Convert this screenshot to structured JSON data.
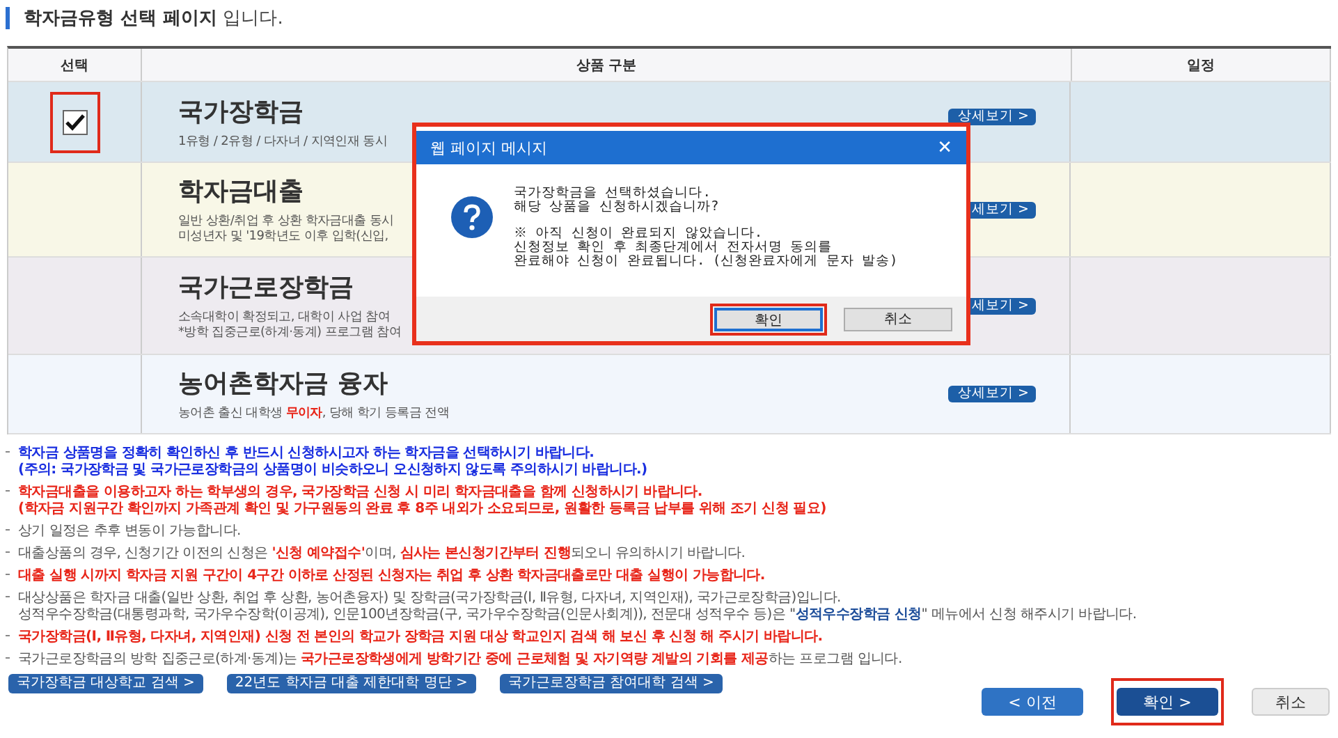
{
  "page_title": {
    "bold": "학자금유형 선택 페이지",
    "rest": "입니다."
  },
  "table": {
    "columns": [
      "선택",
      "상품 구분",
      "일정"
    ],
    "rows": [
      {
        "selected": true,
        "highlighted": true,
        "color": "#dbe8f0",
        "title": "국가장학금",
        "desc": [
          [
            {
              "text": "1유형 / 2유형 / 다자녀 / 지역인재 동시",
              "kind": "plain"
            }
          ]
        ],
        "detail": "상세보기 >"
      },
      {
        "selected": false,
        "highlighted": false,
        "color": "#f8f7e7",
        "title": "학자금대출",
        "desc": [
          [
            {
              "text": "일반 상환/취업 후 상환 학자금대출 동시",
              "kind": "plain"
            }
          ],
          [
            {
              "text": "미성년자 및 '19학년도 이후 입학(신입,",
              "kind": "plain"
            }
          ]
        ],
        "detail": "세보기 >"
      },
      {
        "selected": false,
        "highlighted": false,
        "color": "#eeebf0",
        "title": "국가근로장학금",
        "desc": [
          [
            {
              "text": "소속대학이 확정되고, 대학이 사업 참여",
              "kind": "plain"
            }
          ],
          [
            {
              "text": "*방학 집중근로(하계·동계) 프로그램 참여",
              "kind": "plain"
            }
          ]
        ],
        "detail": "세보기 >"
      },
      {
        "selected": false,
        "highlighted": false,
        "color": "#f2f6fc",
        "title": "농어촌학자금 융자",
        "desc": [
          [
            {
              "text": "농어촌 출신 대학생 ",
              "kind": "plain"
            },
            {
              "text": "무이자",
              "kind": "red"
            },
            {
              "text": ", 당해 학기 등록금 전액",
              "kind": "plain"
            }
          ]
        ],
        "detail": "상세보기 >"
      }
    ]
  },
  "notes": [
    {
      "lines": [
        [
          {
            "text": "학자금 상품명을 정확히 확인하신 후 반드시 신청하시고자 하는 학자금을 선택하시기 바랍니다.",
            "kind": "blue"
          }
        ],
        [
          {
            "text": "(주의: 국가장학금 및 국가근로장학금의 상품명이 비슷하오니 오신청하지 않도록 주의하시기 바랍니다.)",
            "kind": "blue"
          }
        ]
      ]
    },
    {
      "lines": [
        [
          {
            "text": "학자금대출을 이용하고자 하는 학부생의 경우, 국가장학금 신청 시 미리 학자금대출을 함께 신청하시기 바랍니다.",
            "kind": "red"
          }
        ],
        [
          {
            "text": "(학자금 지원구간 확인까지 가족관계 확인 및 가구원동의 완료 후 8주 내외가 소요되므로, 원활한 등록금 납부를 위해 조기 신청 필요)",
            "kind": "red"
          }
        ]
      ]
    },
    {
      "lines": [
        [
          {
            "text": "상기 일정은 추후 변동이 가능합니다.",
            "kind": "plain"
          }
        ]
      ]
    },
    {
      "lines": [
        [
          {
            "text": "대출상품의 경우, 신청기간 이전의 신청은 ",
            "kind": "plain"
          },
          {
            "text": "'신청 예약접수'",
            "kind": "red"
          },
          {
            "text": "이며, ",
            "kind": "plain"
          },
          {
            "text": "심사는 본신청기간부터 진행",
            "kind": "red"
          },
          {
            "text": "되오니 유의하시기 바랍니다.",
            "kind": "plain"
          }
        ]
      ]
    },
    {
      "lines": [
        [
          {
            "text": "대출 실행 시까지 학자금 지원 구간이 4구간 이하로 산정된 신청자는 취업 후 상환 학자금대출로만 대출 실행이 가능합니다.",
            "kind": "red"
          }
        ]
      ]
    },
    {
      "lines": [
        [
          {
            "text": "대상상품은 학자금 대출(일반 상환, 취업 후 상환, 농어촌융자) 및 장학금(국가장학금(Ⅰ, Ⅱ유형, 다자녀, 지역인재), 국가근로장학금)입니다.",
            "kind": "plain"
          }
        ],
        [
          {
            "text": "성적우수장학금(대통령과학, 국가우수장학(이공계), 인문100년장학금(구, 국가우수장학금(인문사회계)), 전문대 성적우수 등)은 \"",
            "kind": "plain"
          },
          {
            "text": "성적우수장학금 신청",
            "kind": "link"
          },
          {
            "text": "\" 메뉴에서 신청 해주시기 바랍니다.",
            "kind": "plain"
          }
        ]
      ]
    },
    {
      "lines": [
        [
          {
            "text": "국가장학금(Ⅰ, Ⅱ유형, 다자녀, 지역인재) 신청 전 본인의 학교가 장학금 지원 대상 학교인지 검색 해 보신 후 신청 해 주시기 바랍니다.",
            "kind": "red"
          }
        ]
      ]
    },
    {
      "lines": [
        [
          {
            "text": "국가근로장학금의 방학 집중근로(하계·동계)는 ",
            "kind": "plain"
          },
          {
            "text": "국가근로장학생에게 방학기간 중에 근로체험 및 자기역량 계발의 기회를 제공",
            "kind": "red"
          },
          {
            "text": "하는 프로그램 입니다.",
            "kind": "plain"
          }
        ]
      ]
    }
  ],
  "link_buttons": [
    "국가장학금 대상학교 검색 >",
    "22년도 학자금 대출 제한대학 명단 >",
    "국가근로장학금 참여대학 검색 >"
  ],
  "nav_buttons": [
    {
      "label": "< 이전",
      "kind": "secondary",
      "highlighted": false
    },
    {
      "label": "확인 >",
      "kind": "primary",
      "highlighted": true
    },
    {
      "label": "취소",
      "kind": "plain",
      "highlighted": false
    }
  ],
  "dialog": {
    "title": "웹 페이지 메시지",
    "close": "✕",
    "highlighted": true,
    "message": [
      "국가장학금을 선택하셨습니다.",
      "해당 상품을 신청하시겠습니까?"
    ],
    "notice": [
      "※ 아직 신청이 완료되지 않았습니다.",
      "신청정보 확인 후 최종단계에서 전자서명 동의를",
      "완료해야 신청이 완료됩니다. (신청완료자에게 문자 발송)"
    ],
    "buttons": [
      {
        "label": "확인",
        "focused": true,
        "highlighted": true
      },
      {
        "label": "취소",
        "focused": false,
        "highlighted": false
      }
    ]
  }
}
